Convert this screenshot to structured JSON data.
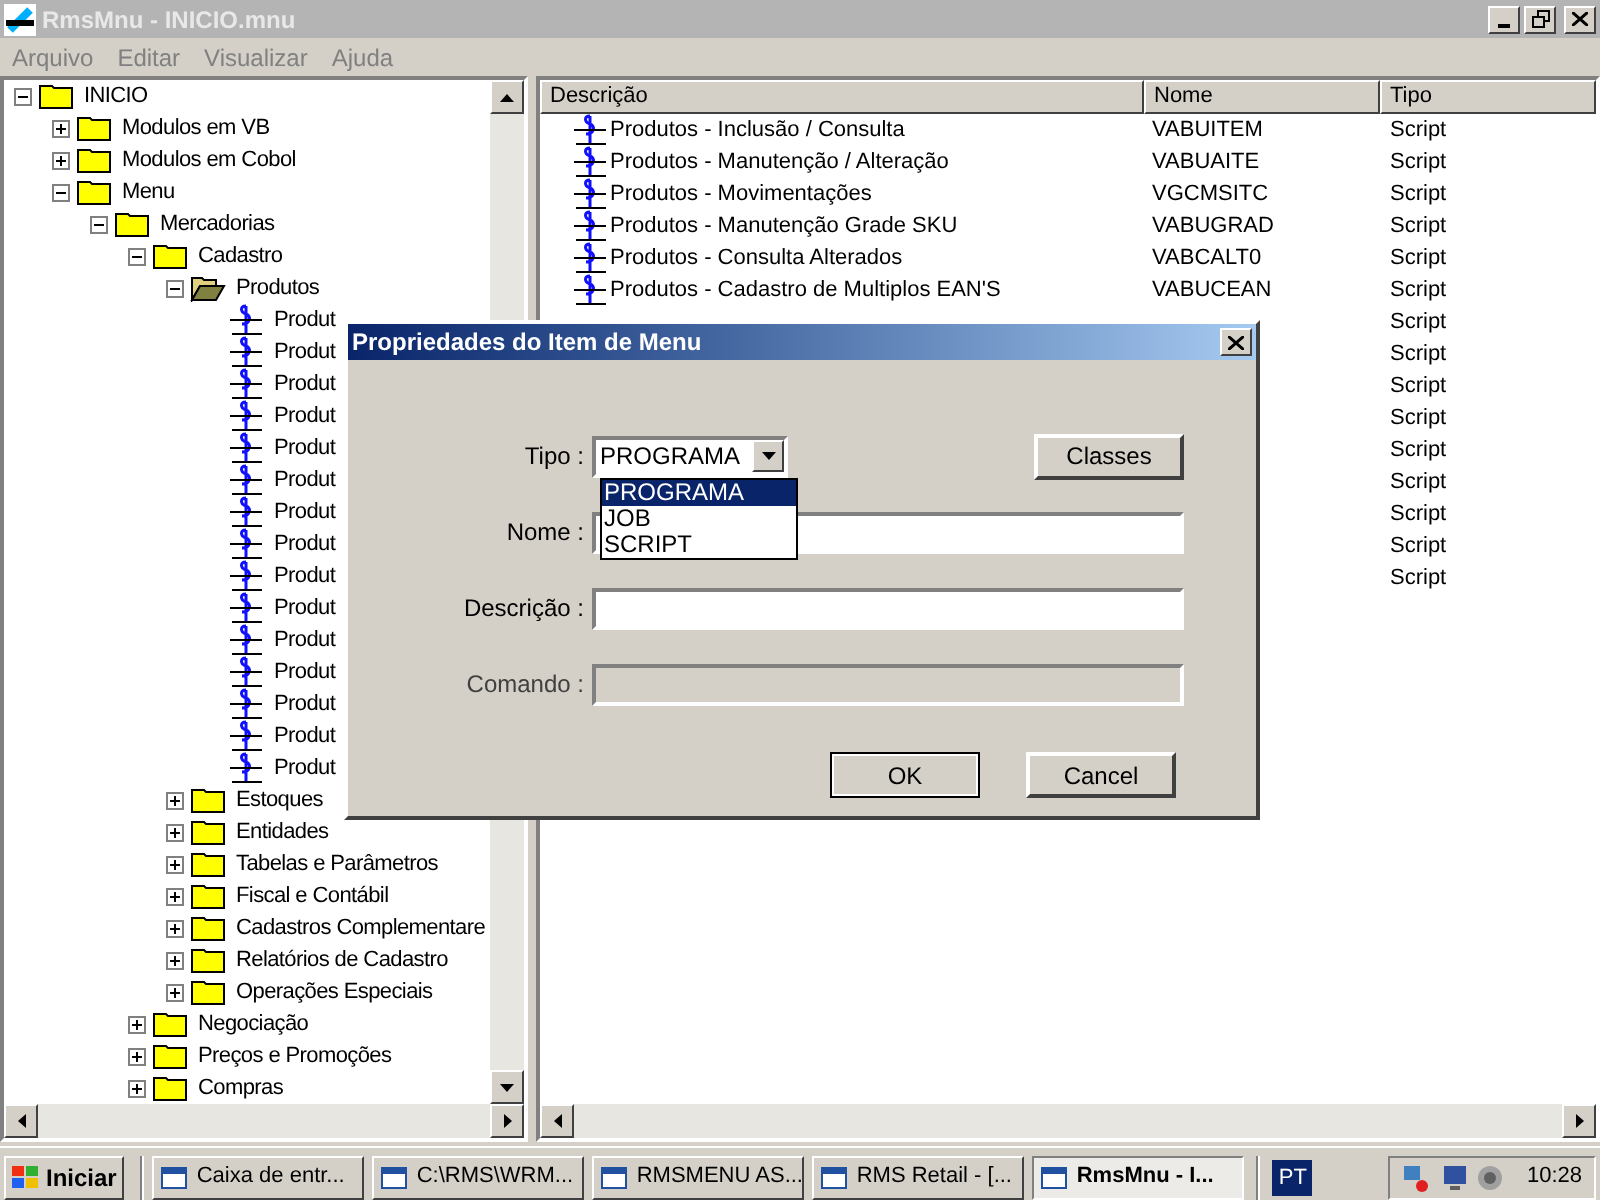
{
  "window": {
    "title": "RmsMnu - INICIO.mnu"
  },
  "menu": [
    "Arquivo",
    "Editar",
    "Visualizar",
    "Ajuda"
  ],
  "tree": [
    {
      "kind": "folder",
      "label": "INICIO",
      "expanded": true,
      "children": [
        {
          "kind": "folder",
          "label": "Modulos em VB",
          "expanded": false
        },
        {
          "kind": "folder",
          "label": "Modulos em Cobol",
          "expanded": false
        },
        {
          "kind": "folder",
          "label": "Menu",
          "expanded": true,
          "children": [
            {
              "kind": "folder",
              "label": "Mercadorias",
              "expanded": true,
              "children": [
                {
                  "kind": "folder",
                  "label": "Cadastro",
                  "expanded": true,
                  "children": [
                    {
                      "kind": "folder",
                      "label": "Produtos",
                      "expanded": true,
                      "selected": true,
                      "children": [
                        {
                          "kind": "script",
                          "label": "Produt"
                        },
                        {
                          "kind": "script",
                          "label": "Produt"
                        },
                        {
                          "kind": "script",
                          "label": "Produt"
                        },
                        {
                          "kind": "script",
                          "label": "Produt"
                        },
                        {
                          "kind": "script",
                          "label": "Produt"
                        },
                        {
                          "kind": "script",
                          "label": "Produt"
                        },
                        {
                          "kind": "script",
                          "label": "Produt"
                        },
                        {
                          "kind": "script",
                          "label": "Produt"
                        },
                        {
                          "kind": "script",
                          "label": "Produt"
                        },
                        {
                          "kind": "script",
                          "label": "Produt"
                        },
                        {
                          "kind": "script",
                          "label": "Produt"
                        },
                        {
                          "kind": "script",
                          "label": "Produt"
                        },
                        {
                          "kind": "script",
                          "label": "Produt"
                        },
                        {
                          "kind": "script",
                          "label": "Produt"
                        },
                        {
                          "kind": "script",
                          "label": "Produt"
                        }
                      ]
                    },
                    {
                      "kind": "folder",
                      "label": "Estoques",
                      "expanded": false
                    },
                    {
                      "kind": "folder",
                      "label": "Entidades",
                      "expanded": false
                    },
                    {
                      "kind": "folder",
                      "label": "Tabelas e Parâmetros",
                      "expanded": false
                    },
                    {
                      "kind": "folder",
                      "label": "Fiscal e Contábil",
                      "expanded": false
                    },
                    {
                      "kind": "folder",
                      "label": "Cadastros Complementare",
                      "expanded": false
                    },
                    {
                      "kind": "folder",
                      "label": "Relatórios de Cadastro",
                      "expanded": false
                    },
                    {
                      "kind": "folder",
                      "label": "Operações Especiais",
                      "expanded": false
                    }
                  ]
                },
                {
                  "kind": "folder",
                  "label": "Negociação",
                  "expanded": false
                },
                {
                  "kind": "folder",
                  "label": "Preços e Promoções",
                  "expanded": false
                },
                {
                  "kind": "folder",
                  "label": "Compras",
                  "expanded": false
                }
              ]
            }
          ]
        }
      ]
    }
  ],
  "table": {
    "columns": [
      "Descrição",
      "Nome",
      "Tipo"
    ],
    "rows": [
      {
        "descricao": "Produtos - Inclusão / Consulta",
        "nome": "VABUITEM",
        "tipo": "Script"
      },
      {
        "descricao": "Produtos - Manutenção / Alteração",
        "nome": "VABUAITE",
        "tipo": "Script"
      },
      {
        "descricao": "Produtos - Movimentações",
        "nome": "VGCMSITC",
        "tipo": "Script"
      },
      {
        "descricao": "Produtos - Manutenção Grade SKU",
        "nome": "VABUGRAD",
        "tipo": "Script"
      },
      {
        "descricao": "Produtos - Consulta Alterados",
        "nome": "VABCALT0",
        "tipo": "Script"
      },
      {
        "descricao": "Produtos - Cadastro de Multiplos EAN'S",
        "nome": "VABUCEAN",
        "tipo": "Script"
      },
      {
        "tipo": "Script"
      },
      {
        "tipo": "Script"
      },
      {
        "tipo": "Script"
      },
      {
        "tipo": "Script"
      },
      {
        "tipo": "Script"
      },
      {
        "tipo": "Script"
      },
      {
        "tipo": "Script"
      },
      {
        "tipo": "Script"
      },
      {
        "tipo": "Script"
      }
    ]
  },
  "dialog": {
    "title": "Propriedades do Item de Menu",
    "tipo": {
      "label": "Tipo :",
      "value": "PROGRAMA",
      "options": [
        {
          "label": "PROGRAMA",
          "selected": true
        },
        {
          "label": "JOB",
          "selected": false
        },
        {
          "label": "SCRIPT",
          "selected": false
        }
      ]
    },
    "fields": [
      {
        "label": "Nome :",
        "disabled": false
      },
      {
        "label": "Descrição :",
        "disabled": false
      },
      {
        "label": "Comando :",
        "disabled": true
      }
    ],
    "classes_button": "Classes",
    "ok_button": "OK",
    "cancel_button": "Cancel"
  },
  "taskbar": {
    "start": "Iniciar",
    "tasks": [
      {
        "label": "Caixa de entr...",
        "selected": false
      },
      {
        "label": "C:\\RMS\\WRM...",
        "selected": false
      },
      {
        "label": "RMSMENU AS...",
        "selected": false
      },
      {
        "label": "RMS Retail - [...",
        "selected": false
      },
      {
        "label": "RmsMnu - I...",
        "selected": true
      }
    ],
    "language": "PT",
    "clock": "10:28"
  }
}
